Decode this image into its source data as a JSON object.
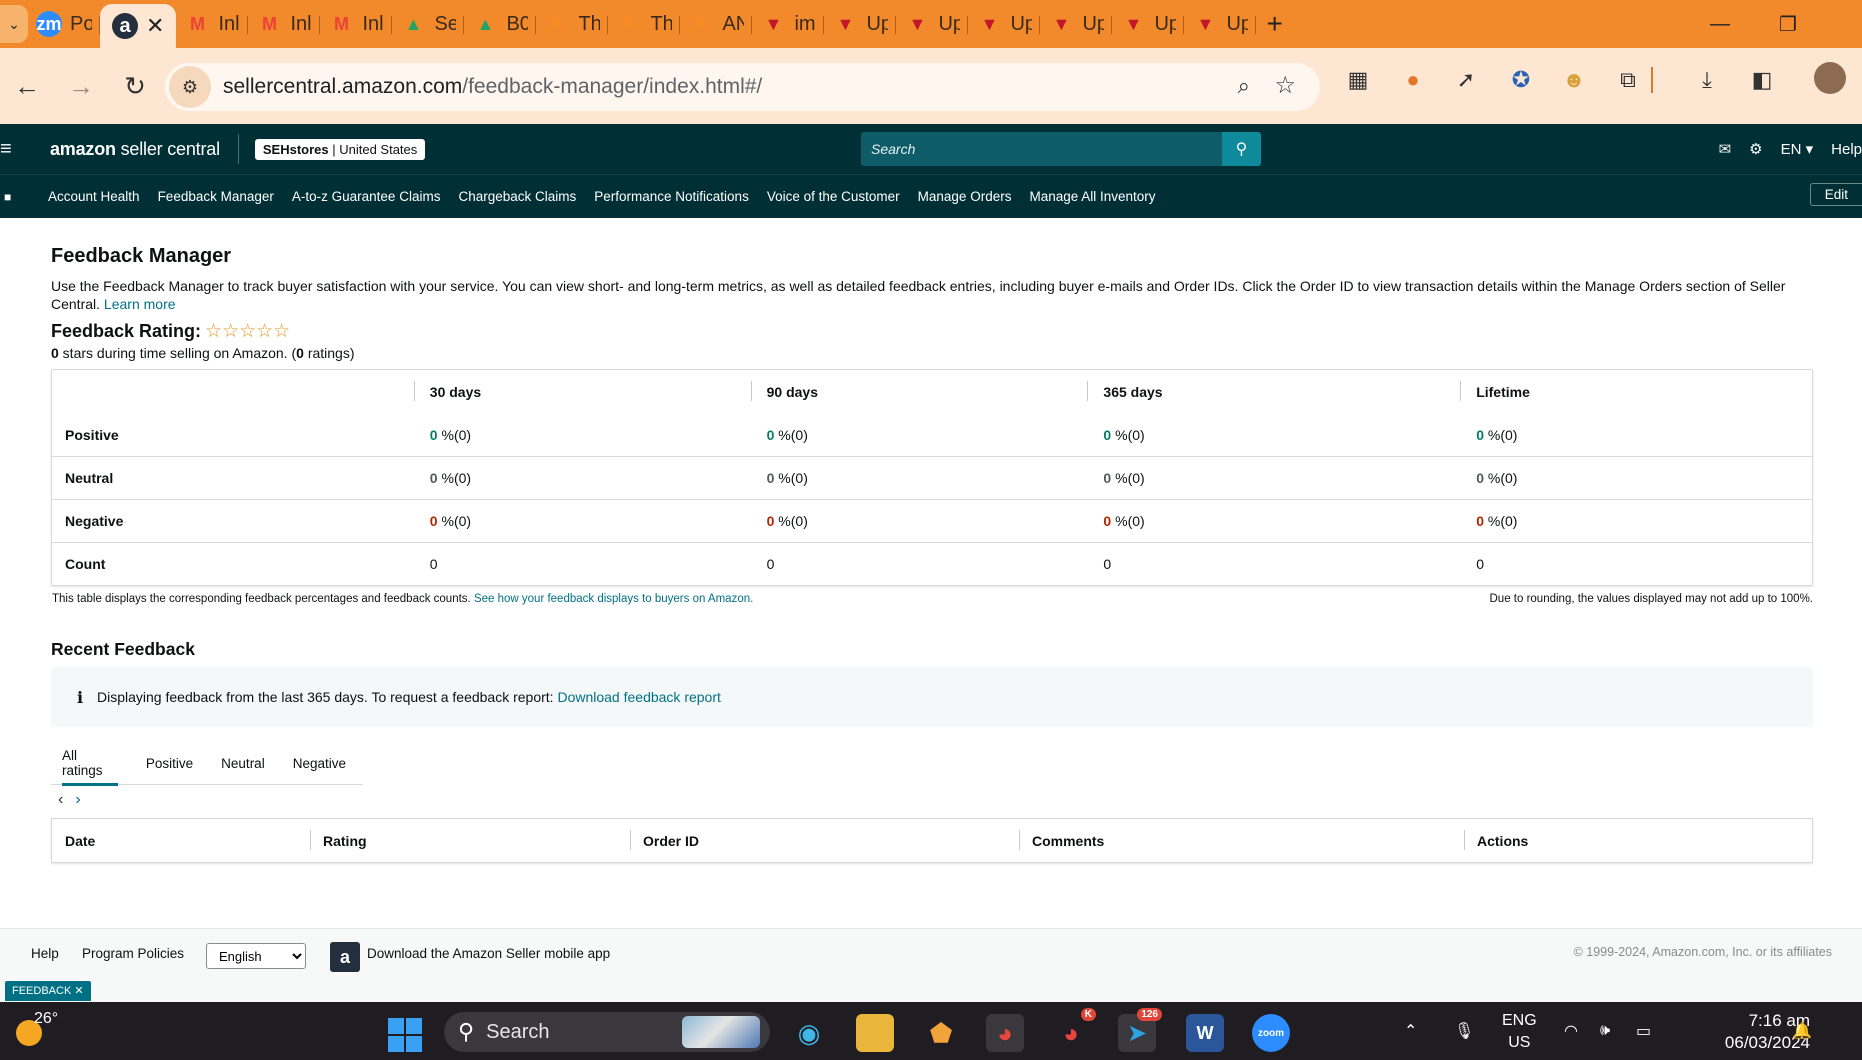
{
  "browser": {
    "tabs": [
      {
        "title": "Po",
        "icon": "zoom-icon",
        "color": "#2d8cff",
        "glyph": "zm"
      },
      {
        "title": "",
        "icon": "amazon-icon",
        "color": "#232f3e",
        "glyph": "a",
        "active": true
      },
      {
        "title": "Inl",
        "icon": "gmail-icon",
        "color": "#ea4335",
        "glyph": "M"
      },
      {
        "title": "Inl",
        "icon": "gmail-icon",
        "color": "#ea4335",
        "glyph": "M"
      },
      {
        "title": "Inl",
        "icon": "gmail-icon",
        "color": "#ea4335",
        "glyph": "M"
      },
      {
        "title": "Se",
        "icon": "google-drive-icon",
        "color": "#1fa463",
        "glyph": "▲"
      },
      {
        "title": "B0",
        "icon": "google-drive-icon",
        "color": "#1fa463",
        "glyph": "▲"
      },
      {
        "title": "Th",
        "icon": "pen-icon",
        "color": "#ff8c1a",
        "glyph": "✎"
      },
      {
        "title": "Th",
        "icon": "pen-icon",
        "color": "#ff8c1a",
        "glyph": "✎"
      },
      {
        "title": "AN",
        "icon": "pen-icon",
        "color": "#ff8c1a",
        "glyph": "✎"
      },
      {
        "title": "im",
        "icon": "upwork-icon",
        "color": "#c4162a",
        "glyph": "▼"
      },
      {
        "title": "Up",
        "icon": "upwork-icon",
        "color": "#c4162a",
        "glyph": "▼"
      },
      {
        "title": "Up",
        "icon": "upwork-icon",
        "color": "#c4162a",
        "glyph": "▼"
      },
      {
        "title": "Up",
        "icon": "upwork-icon",
        "color": "#c4162a",
        "glyph": "▼"
      },
      {
        "title": "Up",
        "icon": "upwork-icon",
        "color": "#c4162a",
        "glyph": "▼"
      },
      {
        "title": "Up",
        "icon": "upwork-icon",
        "color": "#c4162a",
        "glyph": "▼"
      },
      {
        "title": "Up",
        "icon": "upwork-icon",
        "color": "#c4162a",
        "glyph": "▼"
      }
    ],
    "url_host": "sellercentral.amazon.com",
    "url_path": "/feedback-manager/index.html#/"
  },
  "header": {
    "logo_bold": "amazon",
    "logo_rest": " seller central",
    "store_name": "SEHstores",
    "store_region": "United States",
    "search_placeholder": "Search",
    "language": "EN",
    "help": "Help"
  },
  "nav": {
    "items": [
      "Account Health",
      "Feedback Manager",
      "A-to-z Guarantee Claims",
      "Chargeback Claims",
      "Performance Notifications",
      "Voice of the Customer",
      "Manage Orders",
      "Manage All Inventory"
    ],
    "edit": "Edit"
  },
  "page": {
    "title": "Feedback Manager",
    "intro": "Use the Feedback Manager to track buyer satisfaction with your service. You can view short- and long-term metrics, as well as detailed feedback entries, including buyer e-mails and Order IDs. Click the Order ID to view transaction details within the Manage Orders section of Seller Central.",
    "learn_more": "Learn more",
    "rating_label": "Feedback Rating:",
    "stars": "☆☆☆☆☆",
    "stars_count": "0",
    "stars_text": " stars during time selling on Amazon. (",
    "ratings_count": "0",
    "ratings_text": " ratings)"
  },
  "metrics": {
    "columns": [
      "30 days",
      "90 days",
      "365 days",
      "Lifetime"
    ],
    "rows": [
      {
        "label": "Positive",
        "kind": "pos",
        "values": [
          "0",
          "0",
          "0",
          "0"
        ],
        "counts": [
          "(0)",
          "(0)",
          "(0)",
          "(0)"
        ]
      },
      {
        "label": "Neutral",
        "kind": "neu",
        "values": [
          "0",
          "0",
          "0",
          "0"
        ],
        "counts": [
          "(0)",
          "(0)",
          "(0)",
          "(0)"
        ]
      },
      {
        "label": "Negative",
        "kind": "neg",
        "values": [
          "0",
          "0",
          "0",
          "0"
        ],
        "counts": [
          "(0)",
          "(0)",
          "(0)",
          "(0)"
        ]
      }
    ],
    "count_label": "Count",
    "counts": [
      "0",
      "0",
      "0",
      "0"
    ],
    "percent_sign": " %",
    "note_left": "This table displays the corresponding feedback percentages and feedback counts.",
    "note_link": "See how your feedback displays to buyers on Amazon.",
    "note_right": "Due to rounding, the values displayed may not add up to 100%."
  },
  "recent": {
    "title": "Recent Feedback",
    "info": "Displaying feedback from the last 365 days. To request a feedback report:",
    "info_link": "Download feedback report",
    "tabs": [
      "All ratings",
      "Positive",
      "Neutral",
      "Negative"
    ],
    "columns": [
      "Date",
      "Rating",
      "Order ID",
      "Comments",
      "Actions"
    ]
  },
  "footer": {
    "help": "Help",
    "policies": "Program Policies",
    "language": "English",
    "app_text": "Download the Amazon Seller mobile app",
    "copyright": "© 1999-2024, Amazon.com, Inc. or its affiliates",
    "feedback_badge": "FEEDBACK ✕"
  },
  "taskbar": {
    "temperature": "26°",
    "search": "Search",
    "lang_top": "ENG",
    "lang_bottom": "US",
    "time": "7:16 am",
    "date": "06/03/2024",
    "telegram_badge": "126",
    "chrome_badge": "K"
  }
}
